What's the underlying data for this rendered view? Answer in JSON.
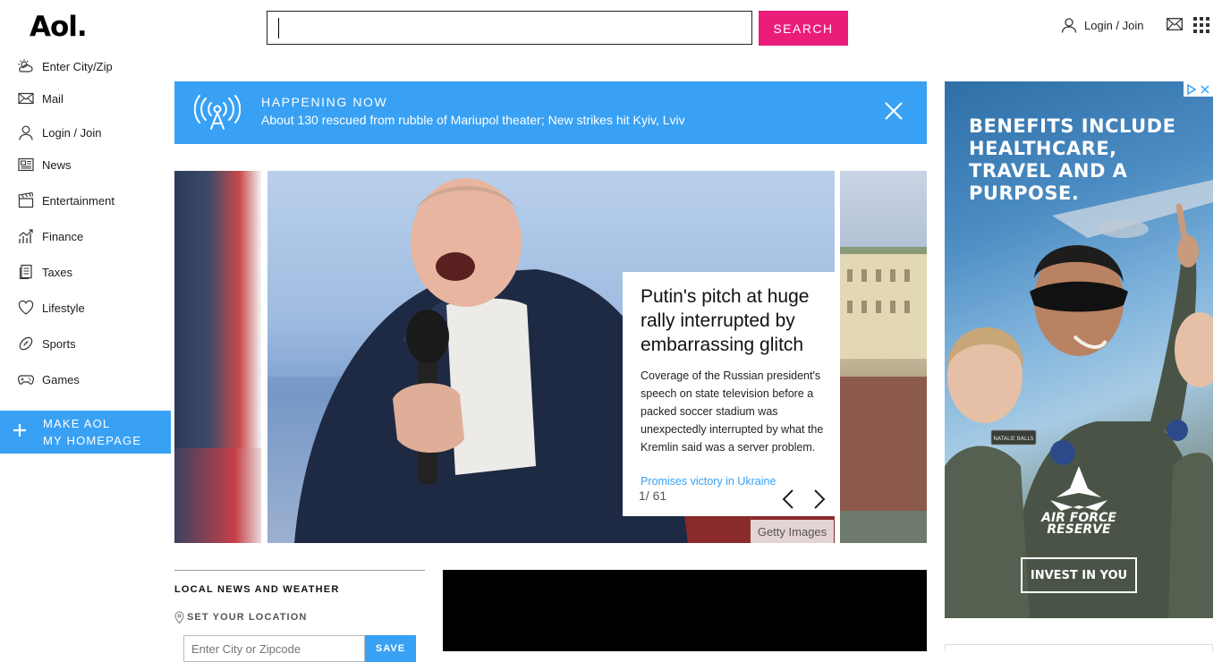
{
  "header": {
    "logo": "Aol.",
    "search_placeholder": "",
    "search_button": "SEARCH",
    "login_label": "Login / Join"
  },
  "sidebar": {
    "items": [
      {
        "label": "Enter City/Zip",
        "icon": "weather-icon"
      },
      {
        "label": "Mail",
        "icon": "mail-icon"
      },
      {
        "label": "Login / Join",
        "icon": "user-icon"
      },
      {
        "label": "News",
        "icon": "news-icon"
      },
      {
        "label": "Entertainment",
        "icon": "clapperboard-icon"
      },
      {
        "label": "Finance",
        "icon": "chart-icon"
      },
      {
        "label": "Taxes",
        "icon": "document-icon"
      },
      {
        "label": "Lifestyle",
        "icon": "heart-icon"
      },
      {
        "label": "Sports",
        "icon": "football-icon"
      },
      {
        "label": "Games",
        "icon": "gamepad-icon"
      }
    ],
    "make_home_line1": "MAKE AOL",
    "make_home_line2": "MY HOMEPAGE"
  },
  "happening_now": {
    "title": "HAPPENING NOW",
    "text": "About 130 rescued from rubble of Mariupol theater; New strikes hit Kyiv, Lviv"
  },
  "slideshow": {
    "title": "Putin's pitch at huge rally interrupted by embarrassing glitch",
    "description": "Coverage of the Russian president's speech on state television before a packed soccer stadium was unexpectedly interrupted by what the Kremlin said was a server problem.",
    "link": "Promises victory in Ukraine",
    "counter": "1/ 61",
    "credit": "Getty Images"
  },
  "local": {
    "title": "LOCAL NEWS AND WEATHER",
    "set_location": "SET YOUR LOCATION",
    "input_placeholder": "Enter City or Zipcode",
    "save_button": "SAVE"
  },
  "ad": {
    "headline": "BENEFITS INCLUDE HEALTHCARE, TRAVEL AND A PURPOSE.",
    "brand_line1": "AIR FORCE",
    "brand_line2": "RESERVE",
    "cta": "INVEST IN YOU",
    "name_tag": "NATALIE BALLS"
  },
  "colors": {
    "accent_blue": "#39a1f4",
    "search_pink": "#eb1d7a"
  }
}
